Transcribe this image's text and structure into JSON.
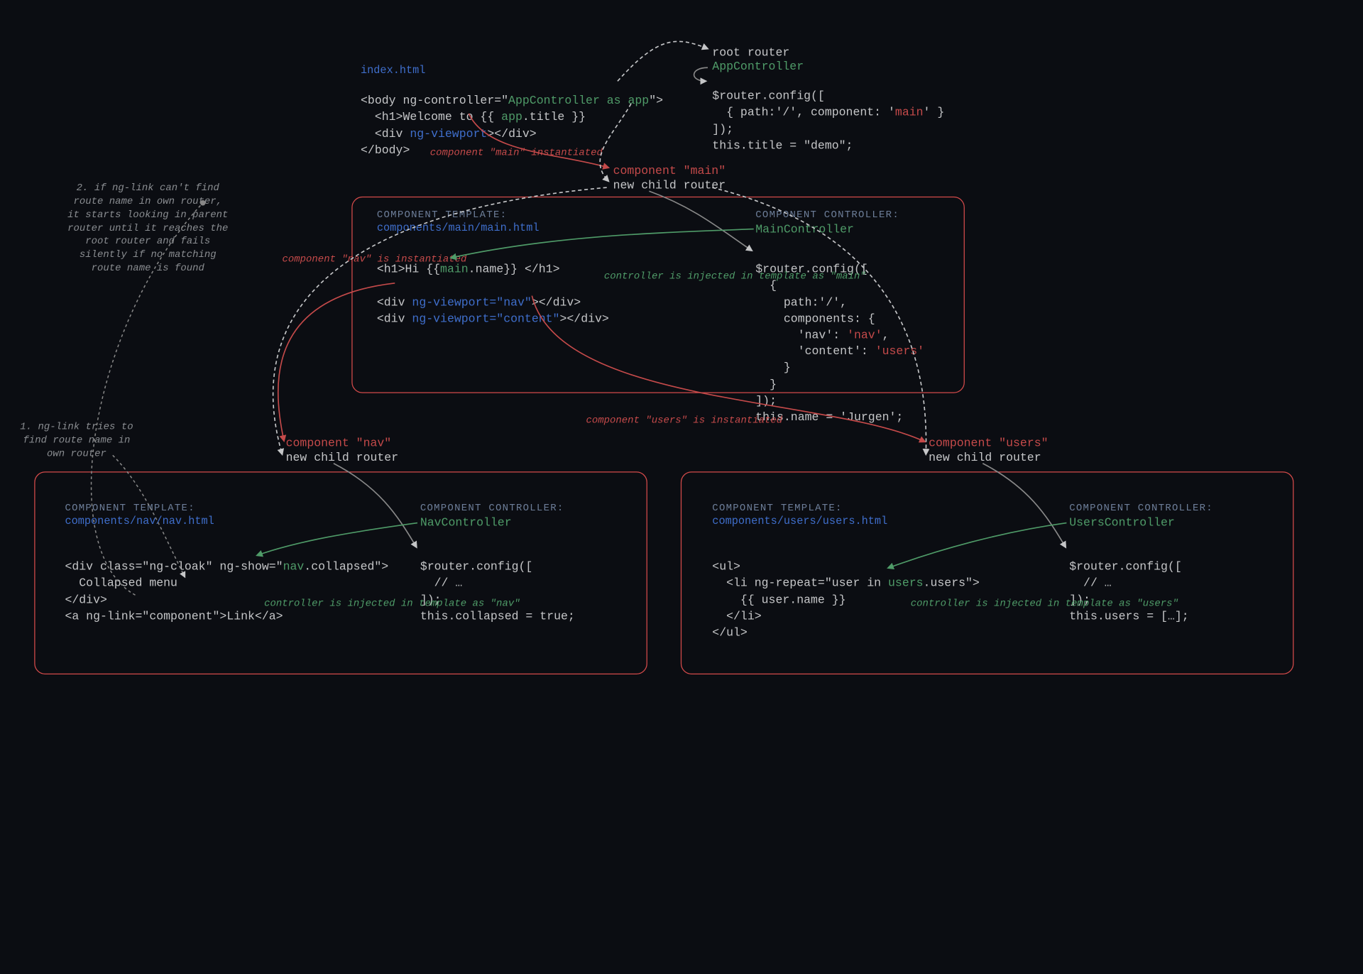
{
  "index": {
    "filename": "index.html",
    "line1_pre": "<body ng-controller=\"",
    "line1_str": "AppController as app",
    "line1_post": "\">",
    "line2_pre": "  <h1>Welcome to {{ ",
    "line2_mid": "app",
    "line2_post": ".title }}",
    "line3_pre": "  <div ",
    "line3_attr": "ng-viewport",
    "line3_post": "></div>",
    "line4": "</body>"
  },
  "root": {
    "label1": "root router",
    "controller": "AppController",
    "cfg1": "$router.config([",
    "cfg2_pre": "  { path:'/', component: '",
    "cfg2_str": "main",
    "cfg2_post": "' }",
    "cfg3": "]);",
    "title": "this.title = \"demo\";"
  },
  "ann_main_inst": "component \"main\"\ninstantiated",
  "headers": {
    "tmpl": "COMPONENT TEMPLATE:",
    "ctrl": "COMPONENT CONTROLLER:"
  },
  "main": {
    "comp_label": "component \"main\"",
    "child_label": "new child router",
    "tmpl_path": "components/main/main.html",
    "tline1_pre": "<h1>Hi {{",
    "tline1_var": "main",
    "tline1_post": ".name}} </h1>",
    "tline3_pre": "<div ",
    "tline3_attr": "ng-viewport=\"nav\"",
    "tline3_post": "></div>",
    "tline4_pre": "<div ",
    "tline4_attr": "ng-viewport=\"content\"",
    "tline4_post": "></div>",
    "ctrl_name": "MainController",
    "cfg": "$router.config([\n  {\n    path:'/',\n    components: {",
    "cfg_nav_k": "      'nav': ",
    "cfg_nav_v": "'nav'",
    "cfg_nav_c": ",",
    "cfg_con_k": "      'content': ",
    "cfg_con_v": "'users'",
    "cfg_close": "    }\n  }\n]);",
    "name_line": "this.name = 'Jurgen';"
  },
  "inj_main": "controller is injected in\ntemplate as \"main\"",
  "nav_inst": "component \"nav\"\nis instantiated",
  "users_inst": "component \"users\" is instantiated",
  "nav": {
    "comp_label": "component \"nav\"",
    "child_label": "new child router",
    "tmpl_path": "components/nav/nav.html",
    "line1_pre": "<div class=\"ng-cloak\" ng-show=\"",
    "line1_var": "nav",
    "line1_post": ".collapsed\">",
    "line2": "  Collapsed menu",
    "line3": "</div>",
    "line4": "<a ng-link=\"component\">Link</a>",
    "ctrl_name": "NavController",
    "cfg": "$router.config([\n  // …\n]);",
    "state": "this.collapsed = true;"
  },
  "inj_nav": "controller is injected in\ntemplate as \"nav\"",
  "users": {
    "comp_label": "component \"users\"",
    "child_label": "new child router",
    "tmpl_path": "components/users/users.html",
    "line1": "<ul>",
    "line2_pre": "  <li ng-repeat=\"user in ",
    "line2_var": "users",
    "line2_post": ".users\">",
    "line3": "    {{ user.name }}",
    "line4": "  </li>",
    "line5": "</ul>",
    "ctrl_name": "UsersController",
    "cfg": "$router.config([\n  // …\n]);",
    "state": "this.users = […];"
  },
  "inj_users": "controller is injected in\ntemplate as \"users\"",
  "note1": "1.\nng-link tries to find route\nname in own router",
  "note2": "2.\nif ng-link can't find route\nname in own router, it\nstarts looking in parent\nrouter until it reaches the\nroot router and fails silently\nif no matching route name\nis found"
}
